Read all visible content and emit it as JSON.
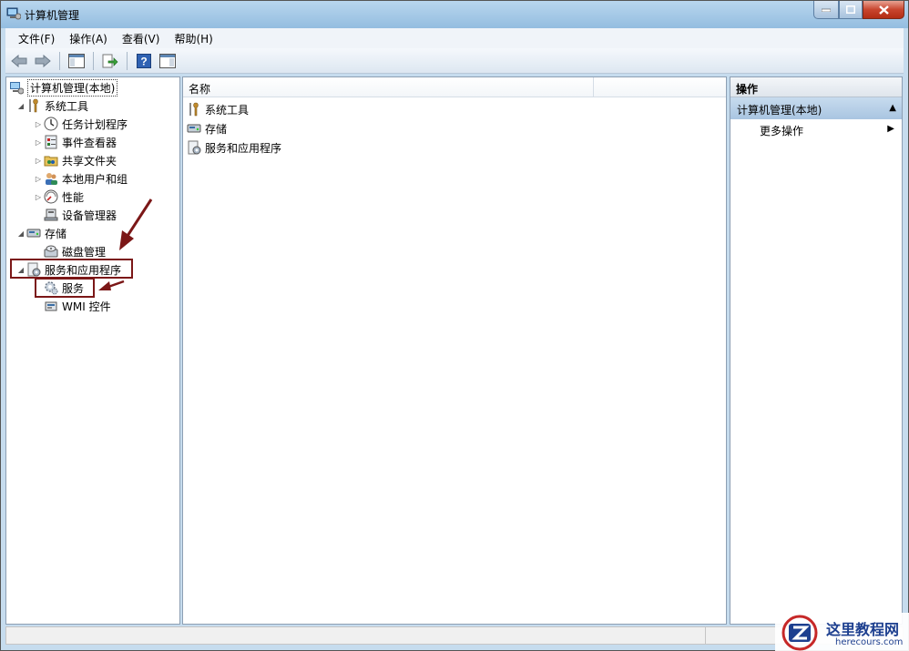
{
  "window": {
    "title": "计算机管理"
  },
  "menu": [
    "文件(F)",
    "操作(A)",
    "查看(V)",
    "帮助(H)"
  ],
  "tree": {
    "root": "计算机管理(本地)",
    "system_tools": "系统工具",
    "task_scheduler": "任务计划程序",
    "event_viewer": "事件查看器",
    "shared_folders": "共享文件夹",
    "local_users": "本地用户和组",
    "performance": "性能",
    "device_manager": "设备管理器",
    "storage": "存储",
    "disk_management": "磁盘管理",
    "services_apps": "服务和应用程序",
    "services": "服务",
    "wmi": "WMI 控件"
  },
  "center": {
    "column_name": "名称",
    "rows": [
      "系统工具",
      "存储",
      "服务和应用程序"
    ]
  },
  "actions": {
    "header": "操作",
    "section": "计算机管理(本地)",
    "more": "更多操作"
  },
  "watermark": {
    "cn": "这里教程网",
    "en": "herecours.com"
  },
  "colors": {
    "annotation": "#7b1717",
    "accent": "#a9c5e1",
    "watermark": "#1d3f8f"
  }
}
